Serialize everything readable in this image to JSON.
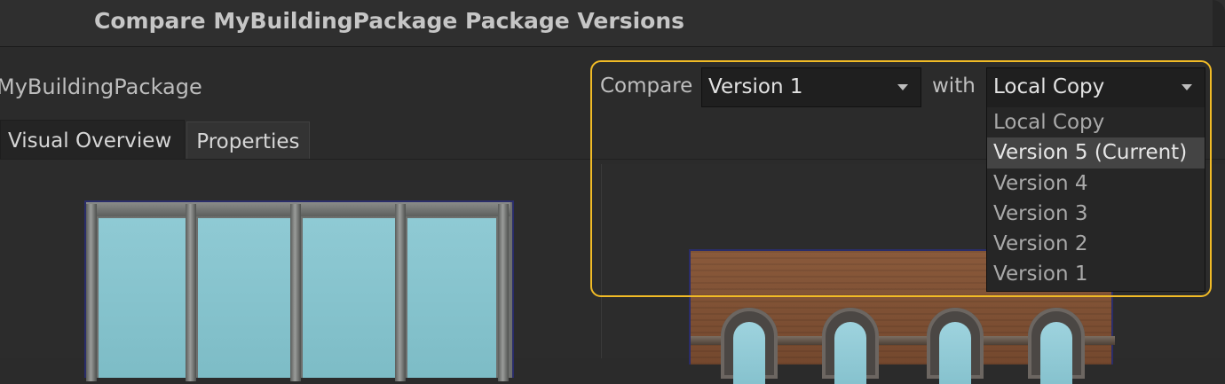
{
  "window": {
    "title": "Compare MyBuildingPackage Package Versions"
  },
  "package": {
    "name": "MyBuildingPackage"
  },
  "tabs": [
    {
      "label": "Visual Overview",
      "active": true
    },
    {
      "label": "Properties",
      "active": false
    }
  ],
  "compare": {
    "compare_label": "Compare",
    "left_selected": "Version 1",
    "with_label": "with",
    "right_selected": "Local Copy",
    "dropdown_open": true,
    "options": [
      {
        "label": "Local Copy",
        "highlighted": false
      },
      {
        "label": "Version 5 (Current)",
        "highlighted": true
      },
      {
        "label": "Version 4",
        "highlighted": false
      },
      {
        "label": "Version 3",
        "highlighted": false
      },
      {
        "label": "Version 2",
        "highlighted": false
      },
      {
        "label": "Version 1",
        "highlighted": false
      }
    ]
  },
  "colors": {
    "highlight_border": "#f1bb26",
    "background": "#2b2b2b"
  },
  "icons": [
    "chevron-down-icon"
  ]
}
